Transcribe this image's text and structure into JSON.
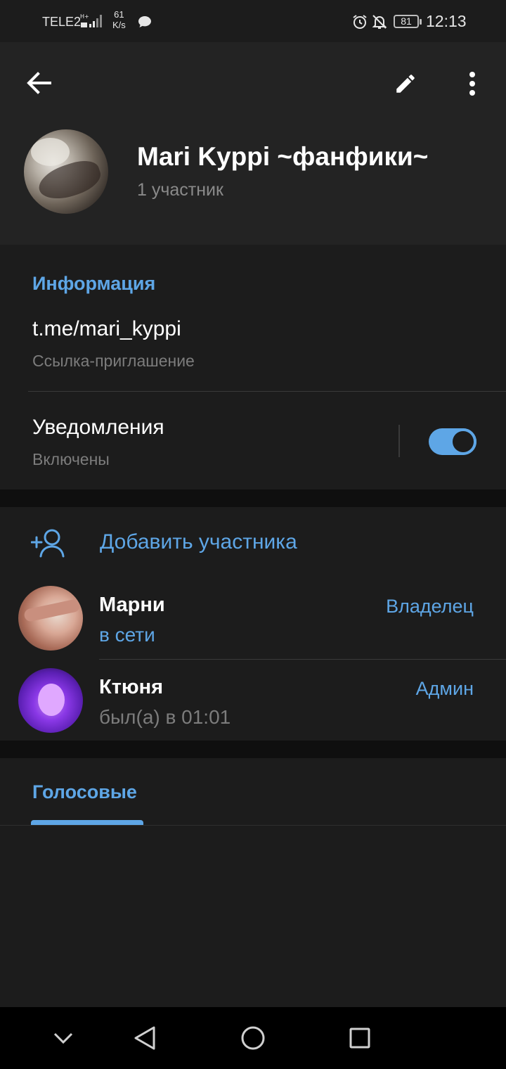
{
  "status_bar": {
    "carrier": "TELE2",
    "speed_value": "61",
    "speed_unit": "K/s",
    "battery": "81",
    "time": "12:13"
  },
  "chat": {
    "title": "Mari Kyppi ~фанфики~",
    "subtitle": "1 участник"
  },
  "info": {
    "section_title": "Информация",
    "link": "t.me/mari_kyppi",
    "link_caption": "Ссылка-приглашение",
    "notifications_label": "Уведомления",
    "notifications_status": "Включены",
    "notifications_enabled": true
  },
  "members": {
    "add_label": "Добавить участника",
    "list": [
      {
        "name": "Марни",
        "status": "в сети",
        "role": "Владелец"
      },
      {
        "name": "Ктюня",
        "status": "был(а) в 01:01",
        "role": "Админ"
      }
    ]
  },
  "media_tabs": {
    "active": "Голосовые"
  },
  "colors": {
    "accent": "#5ea6e6",
    "background": "#1c1c1c",
    "header_background": "#232323"
  }
}
